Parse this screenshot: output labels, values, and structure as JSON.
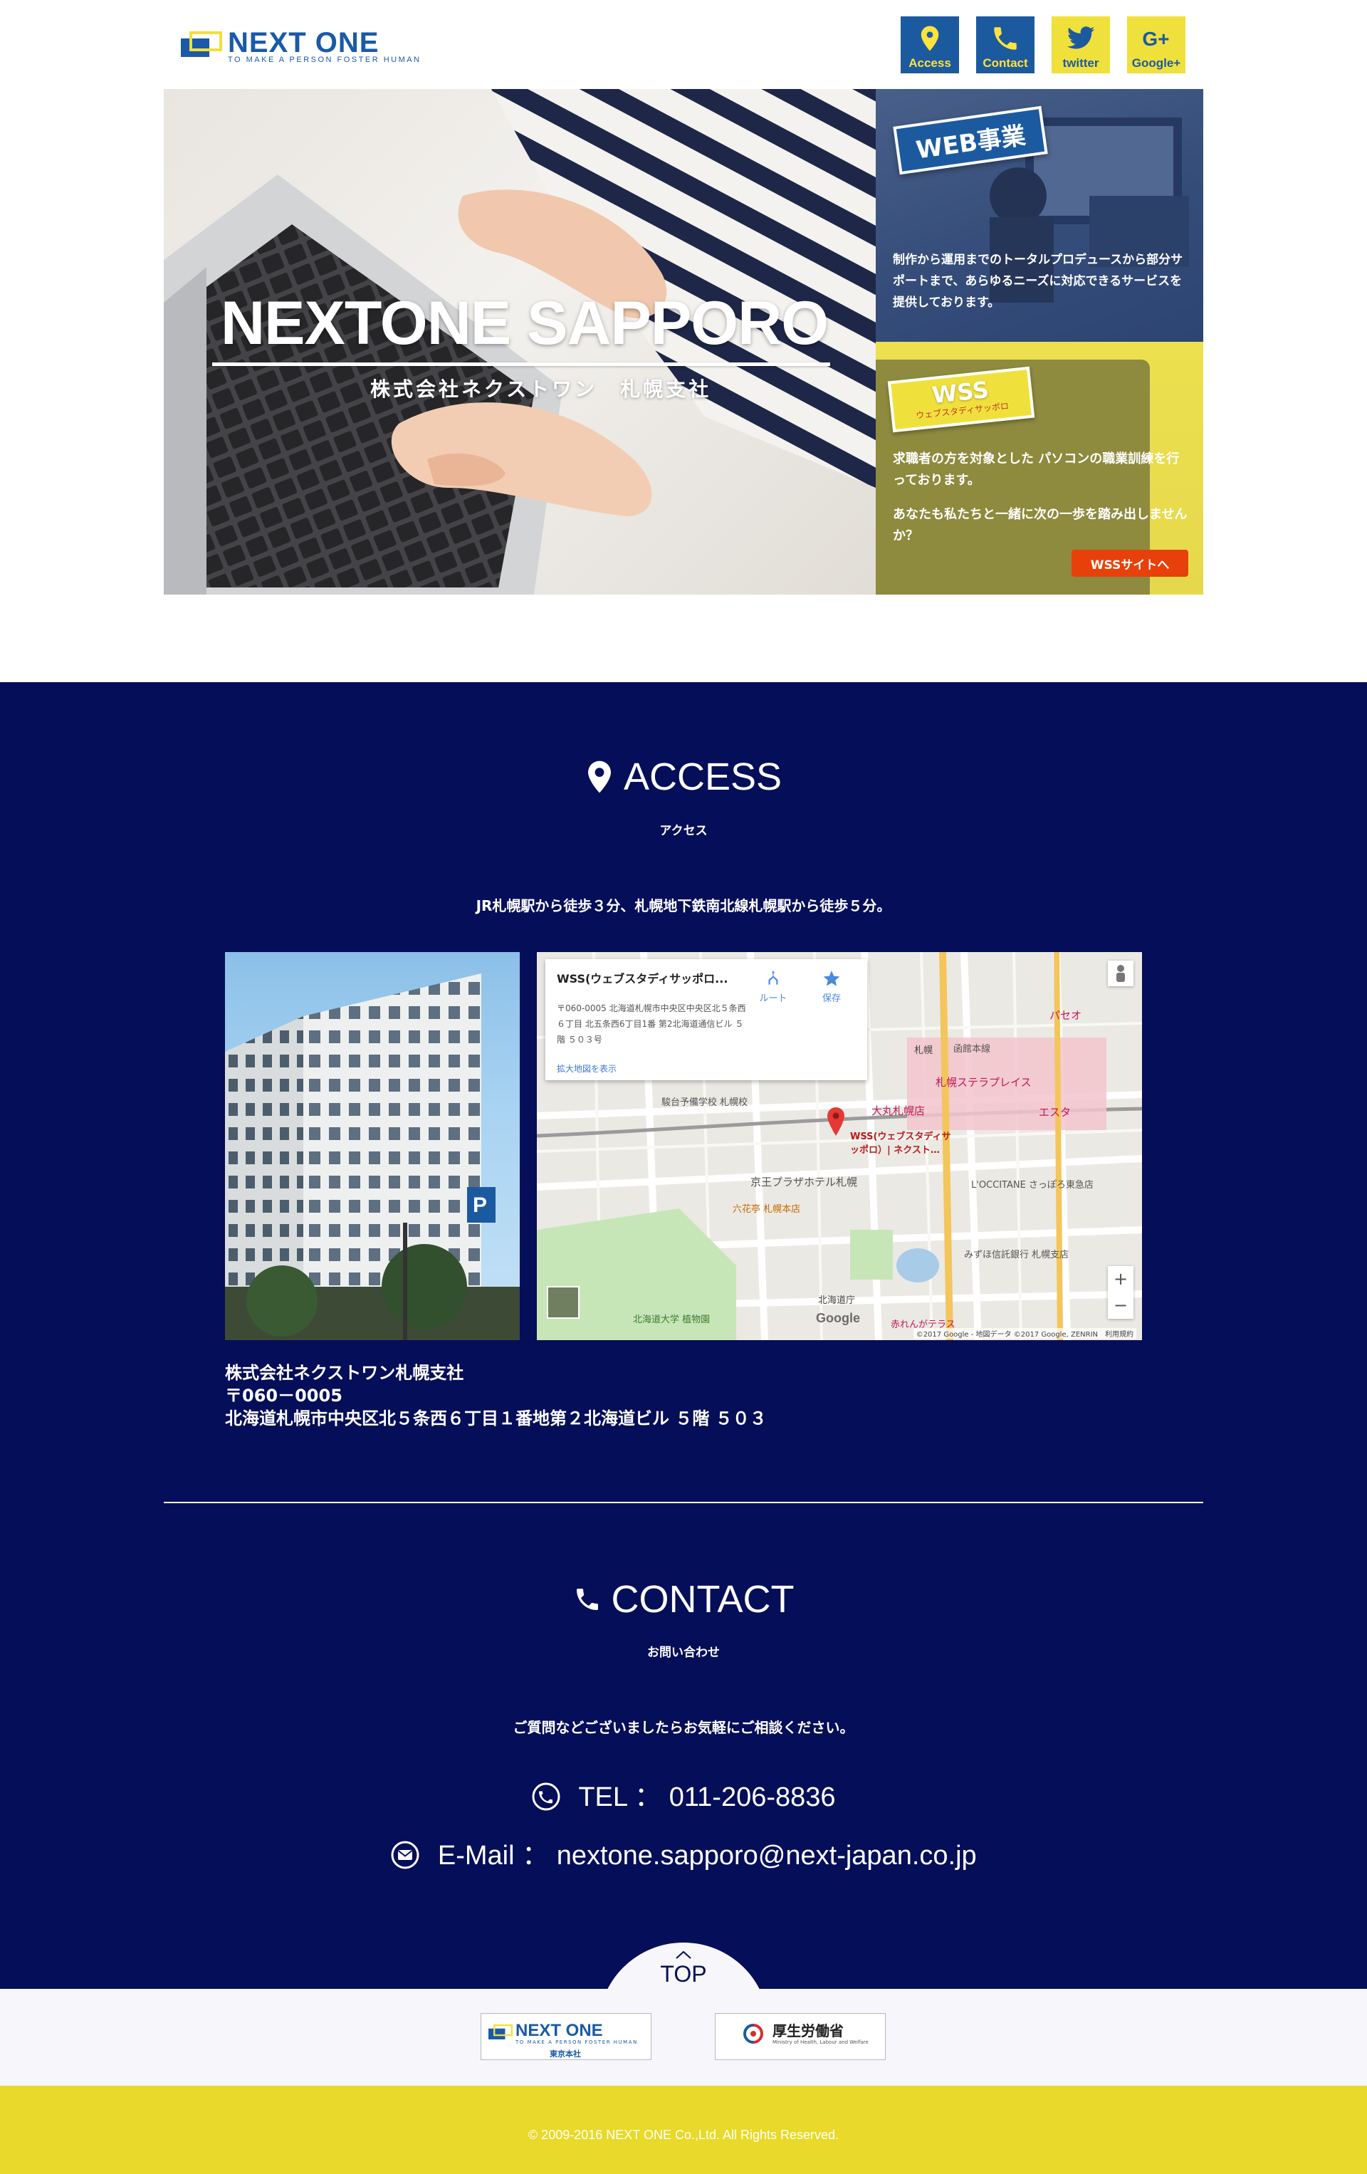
{
  "header": {
    "logo_text": "NEXT ONE",
    "logo_tagline": "TO MAKE A PERSON  FOSTER HUMAN",
    "buttons": [
      {
        "label": "Access",
        "icon": "map-pin-icon"
      },
      {
        "label": "Contact",
        "icon": "phone-icon"
      },
      {
        "label": "twitter",
        "icon": "twitter-icon"
      },
      {
        "label": "Google+",
        "icon": "google-plus-icon"
      }
    ]
  },
  "hero": {
    "title": "NEXTONE SAPPORO",
    "subtitle": "株式会社ネクストワン　札幌支社",
    "web": {
      "badge": "WEB事業",
      "text": "制作から運用までのトータルプロデュースから部分サポートまで、あらゆるニーズに対応できるサービスを提供しております。"
    },
    "wss": {
      "badge": "WSS",
      "badge_sub": "ウェブスタディサッポロ",
      "text1": "求職者の方を対象とした パソコンの職業訓練を行っております。",
      "text2": "あなたも私たちと一緒に次の一歩を踏み出しませんか？",
      "button": "WSSサイトへ"
    }
  },
  "access": {
    "title": "ACCESS",
    "subtitle": "アクセス",
    "description": "JR札幌駅から徒歩３分、札幌地下鉄南北線札幌駅から徒歩５分。",
    "map": {
      "place_name": "WSS(ウェブスタディサッポロ...",
      "address": "〒060-0005 北海道札幌市中央区中央区北５条西６丁目 北五条西6丁目1番 第2北海道通信ビル ５階 ５０３号",
      "route_label": "ルート",
      "save_label": "保存",
      "enlarge_link": "拡大地図を表示",
      "pin_label": "WSS(ウェブスタディサッポロ）| ネクスト…",
      "google": "Google",
      "copyright": "©2017 Google - 地図データ ©2017 Google, ZENRIN　利用規約",
      "labels": {
        "station": "札幌",
        "stellar": "札幌ステラプレイス",
        "daimaru": "大丸札幌店",
        "esta": "エスタ",
        "keio": "京王プラザホテル札幌",
        "rokkatei": "六花亭 札幌本店",
        "sundai": "駿台予備学校 札幌校",
        "doucho": "北海道庁",
        "botanic": "北海道大学 植物園",
        "akarenga": "赤れんがテラス",
        "mizuho": "みずほ信託銀行 札幌支店",
        "occitane": "L'OCCITANE さっぽろ東急店",
        "paseo": "パセオ",
        "hakodate": "函館本線"
      },
      "zoom_in": "+",
      "zoom_out": "−"
    },
    "company": "株式会社ネクストワン札幌支社",
    "postal": "〒060－0005",
    "address": "北海道札幌市中央区北５条西６丁目１番地第２北海道ビル ５階 ５０３"
  },
  "contact": {
    "title": "CONTACT",
    "subtitle": "お問い合わせ",
    "description": "ご質問などございましたらお気軽にご相談ください。",
    "tel_label": "TEL ：",
    "tel": "011-206-8836",
    "email_label": "E-Mail ：",
    "email": "nextone.sapporo@next-japan.co.jp"
  },
  "footer": {
    "top_label": "TOP",
    "partner1": {
      "name": "NEXT ONE",
      "tagline": "TO MAKE A PERSON  FOSTER HUMAN",
      "branch": "東京本社"
    },
    "partner2": {
      "name": "厚生労働省",
      "en": "Ministry of Health, Labour and Welfare"
    },
    "copyright": "© 2009-2016 NEXT ONE Co.,Ltd. All Rights Reserved."
  },
  "colors": {
    "navy": "#050e58",
    "brand_blue": "#1c5aa0",
    "brand_yellow": "#f0e03c",
    "orange": "#e8400a",
    "footer_yellow": "#e8d92a"
  }
}
